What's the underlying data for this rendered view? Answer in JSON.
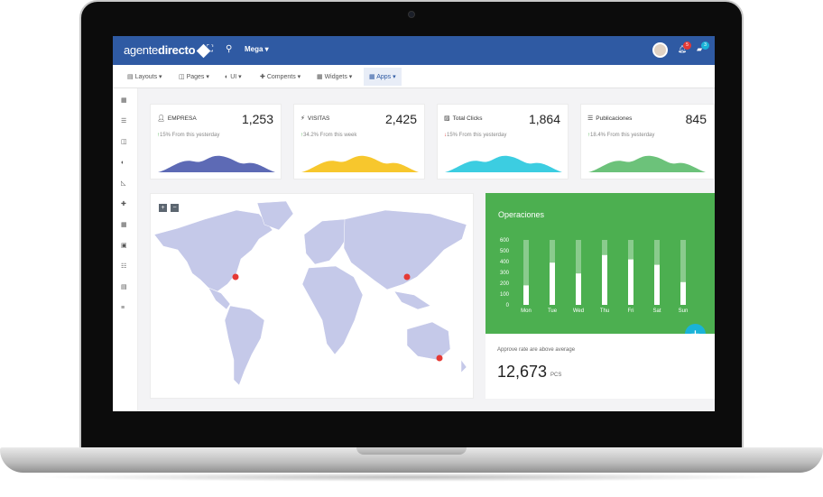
{
  "brand": {
    "name_light": "agente",
    "name_bold": "directo",
    "accent": "#2f5aa3"
  },
  "topbar": {
    "icons": [
      "fullscreen-icon",
      "search-icon"
    ],
    "mega_label": "Mega",
    "notifications_count": "5",
    "messages_count": "3"
  },
  "menu": [
    {
      "label": "Layouts",
      "icon": "layouts-icon"
    },
    {
      "label": "Pages",
      "icon": "pages-icon"
    },
    {
      "label": "UI",
      "icon": "ui-icon"
    },
    {
      "label": "Compents",
      "icon": "components-icon"
    },
    {
      "label": "Widgets",
      "icon": "widgets-icon"
    },
    {
      "label": "Apps",
      "icon": "apps-icon",
      "active": true
    }
  ],
  "sidebar_icons": [
    "dashboard-icon",
    "list-icon",
    "pages-icon",
    "palette-icon",
    "chart-icon",
    "puzzle-icon",
    "grid-icon",
    "calendar-icon",
    "table-icon",
    "form-icon",
    "menu-icon"
  ],
  "stats": [
    {
      "label": "EMPRESA",
      "value": "1,253",
      "delta": "15% From this yesterday",
      "trend": "up",
      "color": "#5d6ab5",
      "icon": "user-icon"
    },
    {
      "label": "VISITAS",
      "value": "2,425",
      "delta": "34.2% From this week",
      "trend": "up",
      "color": "#f7c72d",
      "icon": "bolt-icon"
    },
    {
      "label": "Total Clicks",
      "value": "1,864",
      "delta": "15% From this yesterday",
      "trend": "down",
      "color": "#3ccde1",
      "icon": "image-icon"
    },
    {
      "label": "Publicaciones",
      "value": "845",
      "delta": "18.4% From this yesterday",
      "trend": "up",
      "color": "#6cc27a",
      "icon": "list-icon"
    }
  ],
  "map": {
    "zoom_in": "+",
    "zoom_out": "−",
    "land_color": "#c5c9e9",
    "marker_color": "#e53935"
  },
  "operations": {
    "title": "Operaciones",
    "chart_data": {
      "type": "bar",
      "categories": [
        "Mon",
        "Tue",
        "Wed",
        "Thu",
        "Fri",
        "Sat",
        "Sun"
      ],
      "values": [
        180,
        390,
        290,
        460,
        420,
        370,
        210
      ],
      "ylim": [
        0,
        600
      ],
      "yticks": [
        "600",
        "500",
        "400",
        "300",
        "200",
        "100",
        "0"
      ]
    }
  },
  "approve": {
    "caption": "Approve rate are above average",
    "value": "12,673",
    "unit": "PCS"
  },
  "fab_label": "+"
}
